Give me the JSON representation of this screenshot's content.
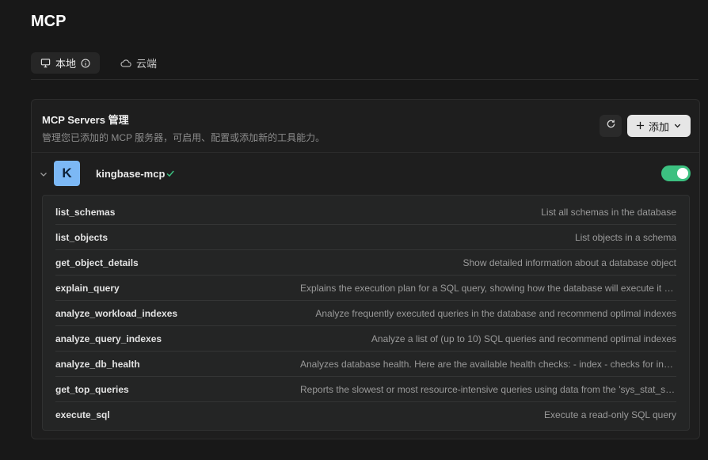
{
  "page": {
    "title": "MCP"
  },
  "tabs": [
    {
      "label": "本地",
      "icon": "monitor-icon",
      "active": true
    },
    {
      "label": "云端",
      "icon": "cloud-icon",
      "active": false
    }
  ],
  "servers_panel": {
    "title": "MCP Servers 管理",
    "subtitle": "管理您已添加的 MCP 服务器，可启用、配置或添加新的工具能力。",
    "add_label": "添加"
  },
  "server": {
    "logo_letter": "K",
    "name": "kingbase-mcp",
    "enabled": true
  },
  "tools": [
    {
      "name": "list_schemas",
      "description": "List all schemas in the database"
    },
    {
      "name": "list_objects",
      "description": "List objects in a schema"
    },
    {
      "name": "get_object_details",
      "description": "Show detailed information about a database object"
    },
    {
      "name": "explain_query",
      "description": "Explains the execution plan for a SQL query, showing how the database will execute it and provide details"
    },
    {
      "name": "analyze_workload_indexes",
      "description": "Analyze frequently executed queries in the database and recommend optimal indexes"
    },
    {
      "name": "analyze_query_indexes",
      "description": "Analyze a list of (up to 10) SQL queries and recommend optimal indexes"
    },
    {
      "name": "analyze_db_health",
      "description": "Analyzes database health. Here are the available health checks: - index - checks for invalid indexes"
    },
    {
      "name": "get_top_queries",
      "description": "Reports the slowest or most resource-intensive queries using data from the 'sys_stat_statements' extension"
    },
    {
      "name": "execute_sql",
      "description": "Execute a read-only SQL query"
    }
  ],
  "colors": {
    "background": "#181818",
    "accent_toggle": "#3cc080",
    "logo": "#7cb8f5",
    "check": "#3cc080"
  }
}
